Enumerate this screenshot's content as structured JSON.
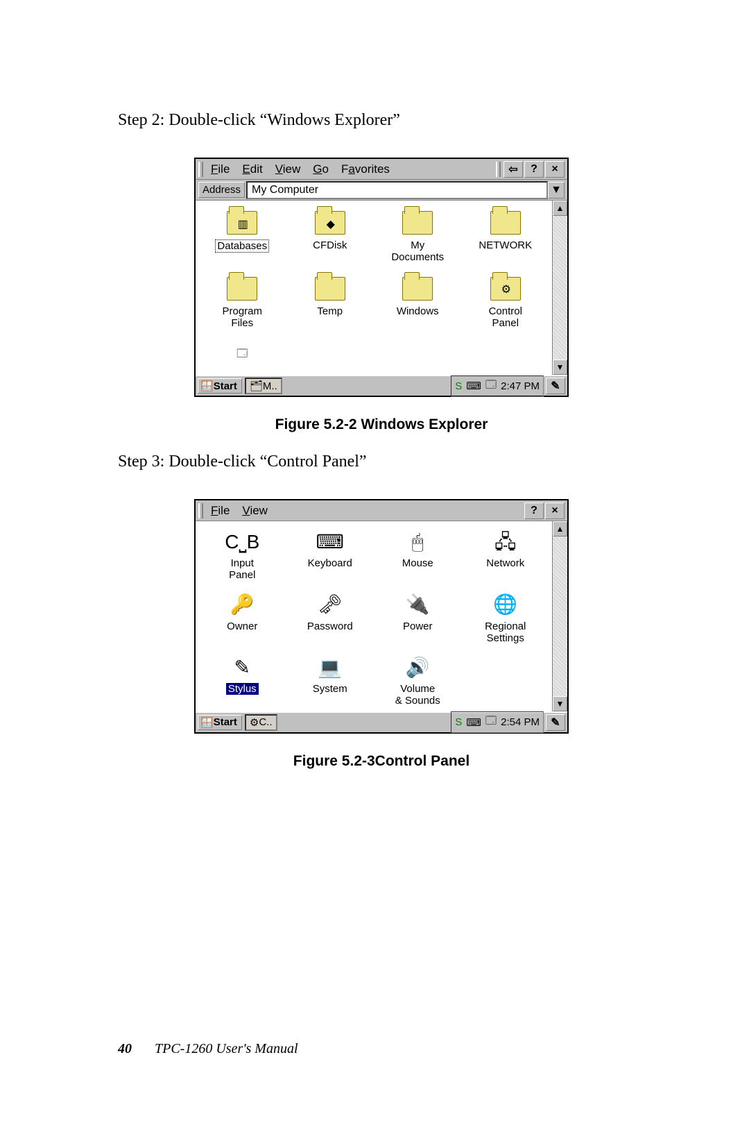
{
  "step2": "Step 2: Double-click “Windows Explorer”",
  "caption1": "Figure 5.2-2 Windows Explorer",
  "step3": "Step 3: Double-click “Control Panel”",
  "caption2": "Figure 5.2-3Control Panel",
  "footer": {
    "page": "40",
    "title": "TPC-1260   User's Manual"
  },
  "ss1": {
    "menu": {
      "file": "File",
      "edit": "Edit",
      "view": "View",
      "go": "Go",
      "fav": "Favorites",
      "help": "?",
      "close": "×",
      "back": "⇦"
    },
    "addr": {
      "label": "Address",
      "value": "My Computer",
      "drop": "▼"
    },
    "icons": [
      {
        "label": "Databases",
        "selected": true,
        "kind": "folder",
        "ovl": "▥"
      },
      {
        "label": "CFDisk",
        "kind": "folder",
        "ovl": "◆"
      },
      {
        "label": "My Documents",
        "kind": "folder",
        "ovl": ""
      },
      {
        "label": "NETWORK",
        "kind": "folder",
        "ovl": ""
      },
      {
        "label": "Program Files",
        "kind": "folder",
        "ovl": ""
      },
      {
        "label": "Temp",
        "kind": "folder",
        "ovl": ""
      },
      {
        "label": "Windows",
        "kind": "folder",
        "ovl": ""
      },
      {
        "label": "Control Panel",
        "kind": "cpanel",
        "ovl": "⚙"
      }
    ],
    "extra_icon": "⧉",
    "scroll": {
      "up": "▲",
      "down": "▼"
    },
    "taskbar": {
      "start": "Start",
      "task": "M..",
      "s": "S",
      "time": "2:47 PM",
      "kbd": "⌨",
      "dt": "🖥"
    }
  },
  "ss2": {
    "menu": {
      "file": "File",
      "view": "View",
      "help": "?",
      "close": "×"
    },
    "icons": [
      {
        "label": "Input Panel",
        "glyph": "C⎵B"
      },
      {
        "label": "Keyboard",
        "glyph": "⌨"
      },
      {
        "label": "Mouse",
        "glyph": "🖱"
      },
      {
        "label": "Network",
        "glyph": "🖧"
      },
      {
        "label": "Owner",
        "glyph": "🔑"
      },
      {
        "label": "Password",
        "glyph": "🗝"
      },
      {
        "label": "Power",
        "glyph": "🔌"
      },
      {
        "label": "Regional Settings",
        "glyph": "🌐"
      },
      {
        "label": "Stylus",
        "glyph": "✎",
        "selected": true
      },
      {
        "label": "System",
        "glyph": "💻"
      },
      {
        "label": "Volume & Sounds",
        "glyph": "🔊"
      }
    ],
    "scroll": {
      "up": "▲",
      "down": "▼"
    },
    "taskbar": {
      "start": "Start",
      "task": "C..",
      "s": "S",
      "time": "2:54 PM",
      "kbd": "⌨",
      "dt": "🖥"
    }
  }
}
